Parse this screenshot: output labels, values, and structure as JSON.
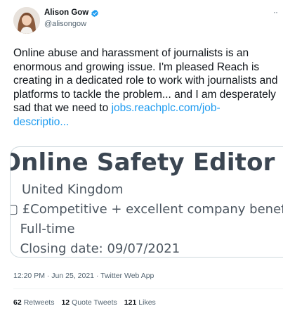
{
  "author": {
    "display_name": "Alison Gow",
    "handle": "@alisongow",
    "verified": true
  },
  "more_label": "··",
  "tweet": {
    "lines": [
      "Online abuse and harassment of journalists is an",
      "enormous and growing issue. I'm pleased Reach is",
      "creating in a dedicated role to work with journalists and",
      "platforms to tackle the problem... and I am desperately"
    ],
    "line5_prefix": "sad that we need to ",
    "link_part1": "jobs.reachplc.com/job-",
    "link_part2": "descriptio..."
  },
  "card": {
    "title": "Online Safety Editor",
    "location": "United Kingdom",
    "salary": "£Competitive + excellent company benefits",
    "job_type": "Full-time",
    "closing": "Closing date: 09/07/2021"
  },
  "meta": {
    "timestamp": "12:20 PM · Jun 25, 2021 · Twitter Web App"
  },
  "stats": {
    "retweets_count": "62",
    "retweets_label": "Retweets",
    "quotes_count": "12",
    "quotes_label": "Quote Tweets",
    "likes_count": "121",
    "likes_label": "Likes"
  },
  "colors": {
    "link": "#1d9bf0",
    "verified": "#1d9bf0",
    "secondary_text": "#536471"
  }
}
